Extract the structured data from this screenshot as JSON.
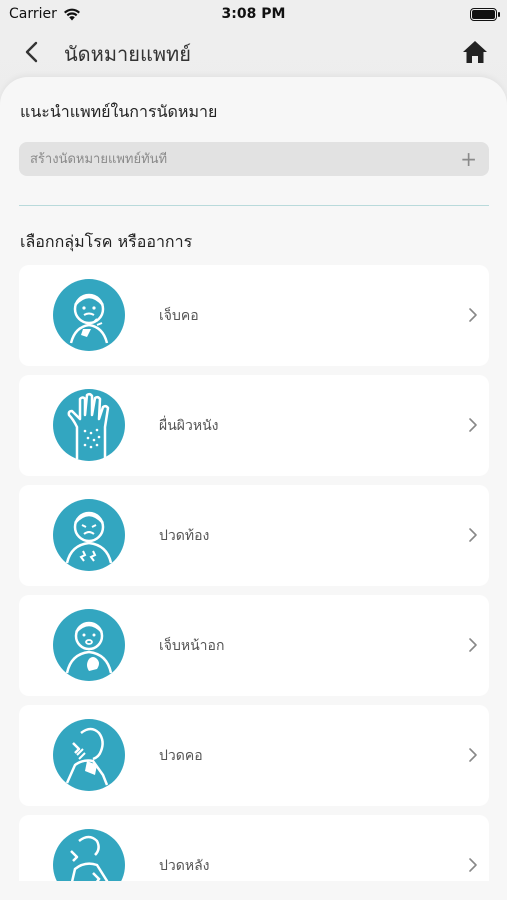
{
  "status_bar": {
    "carrier": "Carrier",
    "time": "3:08 PM"
  },
  "nav": {
    "title": "นัดหมายแพทย์",
    "back_icon": "chevron-left-icon",
    "home_icon": "home-icon"
  },
  "recommend": {
    "title": "แนะนำแพทย์ในการนัดหมาย",
    "create_placeholder": "สร้างนัดหมายแพทย์ทันที",
    "plus_icon": "plus-icon"
  },
  "category": {
    "title": "เลือกกลุ่มโรค หรืออาการ",
    "items": [
      {
        "label": "เจ็บคอ",
        "icon": "sore-throat-icon"
      },
      {
        "label": "ผื่นผิวหนัง",
        "icon": "skin-rash-icon"
      },
      {
        "label": "ปวดท้อง",
        "icon": "stomach-ache-icon"
      },
      {
        "label": "เจ็บหน้าอก",
        "icon": "chest-pain-icon"
      },
      {
        "label": "ปวดคอ",
        "icon": "neck-pain-icon"
      },
      {
        "label": "ปวดหลัง",
        "icon": "back-pain-icon"
      }
    ]
  },
  "colors": {
    "accent": "#33a6c0",
    "card": "#ffffff",
    "sheet": "#f7f7f7"
  }
}
